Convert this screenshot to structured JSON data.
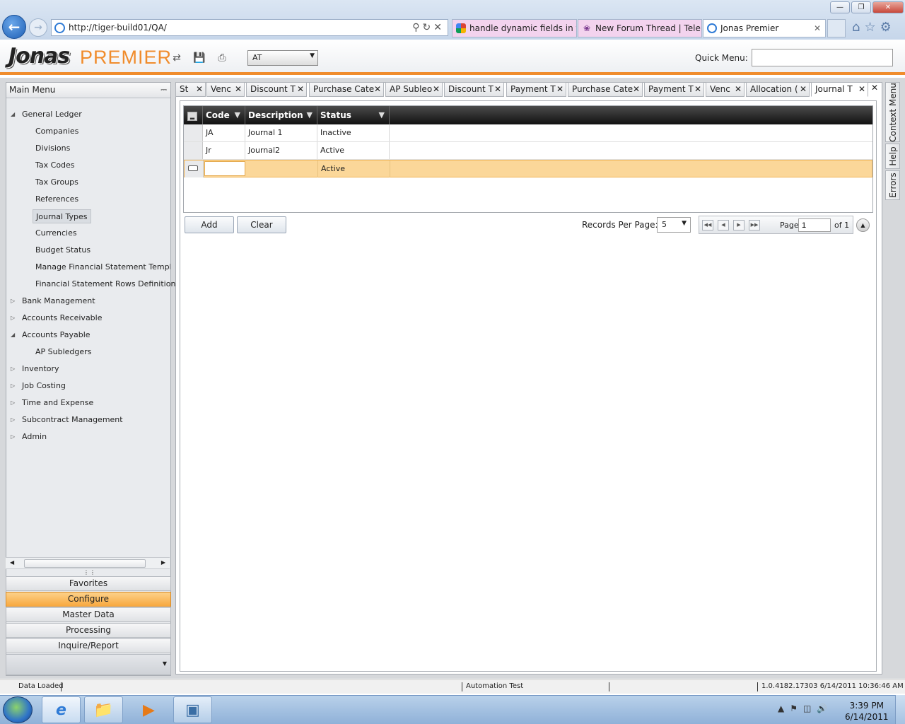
{
  "browser": {
    "address": "http://tiger-build01/QA/",
    "tabs": [
      {
        "label": "handle dynamic fields in t..."
      },
      {
        "label": "New Forum Thread | Telerik"
      },
      {
        "label": "Jonas Premier"
      }
    ]
  },
  "app": {
    "logo_text": "Jonas",
    "product": "PREMIER",
    "company_selected": "AT",
    "quick_menu_label": "Quick Menu:",
    "quick_menu_value": ""
  },
  "main_menu": {
    "title": "Main Menu",
    "tree": [
      {
        "label": "General Ledger",
        "expanded": true,
        "children": [
          "Companies",
          "Divisions",
          "Tax Codes",
          "Tax Groups",
          "References",
          "Journal Types",
          "Currencies",
          "Budget Status",
          "Manage Financial Statement Template",
          "Financial Statement Rows Definition"
        ]
      },
      {
        "label": "Bank Management",
        "expanded": false
      },
      {
        "label": "Accounts Receivable",
        "expanded": false
      },
      {
        "label": "Accounts Payable",
        "expanded": true,
        "children": [
          "AP Subledgers"
        ]
      },
      {
        "label": "Inventory",
        "expanded": false
      },
      {
        "label": "Job Costing",
        "expanded": false
      },
      {
        "label": "Time and Expense",
        "expanded": false
      },
      {
        "label": "Subcontract Management",
        "expanded": false
      },
      {
        "label": "Admin",
        "expanded": false
      }
    ],
    "selected": "Journal Types",
    "sections": [
      "Favorites",
      "Configure",
      "Master Data",
      "Processing",
      "Inquire/Report"
    ],
    "active_section": "Configure"
  },
  "content_tabs": [
    "St",
    "Venc",
    "Discount T",
    "Purchase Cate",
    "AP Subleο",
    "Discount T",
    "Payment T",
    "Purchase Cate",
    "Payment T",
    "Venc",
    "Allocation (",
    "Journal T"
  ],
  "active_tab": "Journal T",
  "grid": {
    "columns": [
      "Code",
      "Description",
      "Status"
    ],
    "rows": [
      {
        "code": "JA",
        "description": "Journal 1",
        "status": "Inactive"
      },
      {
        "code": "Jr",
        "description": "Journal2",
        "status": "Active"
      }
    ],
    "new_row": {
      "code": "",
      "description": "",
      "status": "Active"
    }
  },
  "buttons": {
    "add": "Add",
    "clear": "Clear"
  },
  "pager": {
    "records_per_page_label": "Records Per Page:",
    "records_per_page": "5",
    "page_label": "Page",
    "page": "1",
    "of_label": "of 1"
  },
  "side_tabs": [
    "Context Menu",
    "Help",
    "Errors"
  ],
  "status": {
    "left": "Data Loaded",
    "middle": "Automation Test",
    "right": "1.0.4182.17303 6/14/2011 10:36:46 AM"
  },
  "taskbar": {
    "time": "3:39 PM",
    "date": "6/14/2011"
  }
}
